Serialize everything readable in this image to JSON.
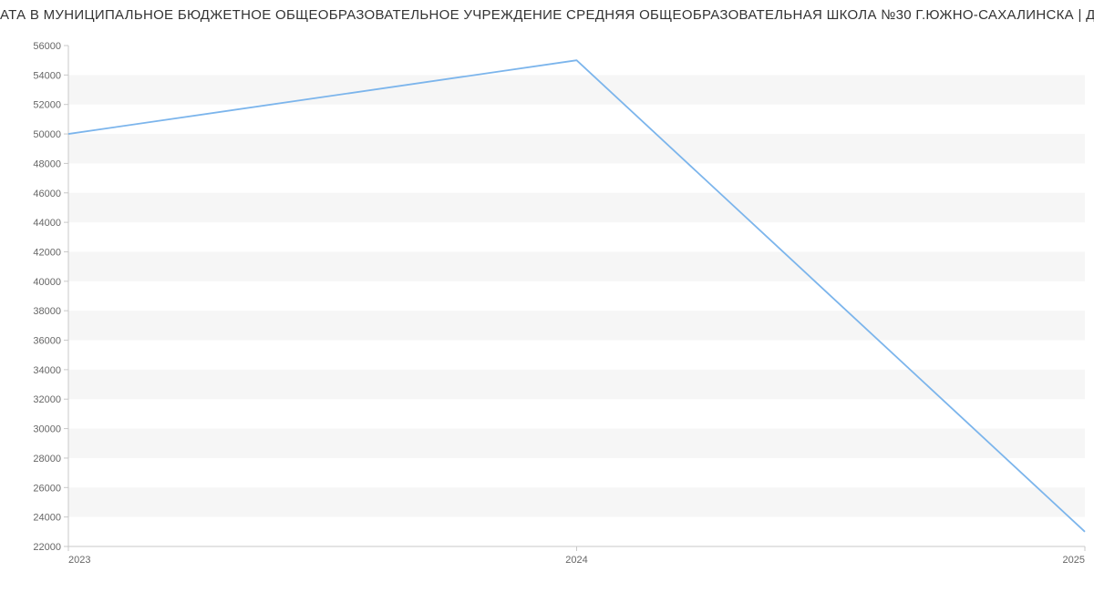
{
  "title": "АТА В МУНИЦИПАЛЬНОЕ БЮДЖЕТНОЕ ОБЩЕОБРАЗОВАТЕЛЬНОЕ УЧРЕЖДЕНИЕ СРЕДНЯЯ ОБЩЕОБРАЗОВАТЕЛЬНАЯ ШКОЛА №30 Г.ЮЖНО-САХАЛИНСКА | Данные mnogo",
  "chart_data": {
    "type": "line",
    "x": [
      2023,
      2024,
      2025
    ],
    "values": [
      50000,
      55000,
      23000
    ],
    "xlabel": "",
    "ylabel": "",
    "xlim": [
      2023,
      2025
    ],
    "ylim": [
      22000,
      56000
    ],
    "yticks": [
      22000,
      24000,
      26000,
      28000,
      30000,
      32000,
      34000,
      36000,
      38000,
      40000,
      42000,
      44000,
      46000,
      48000,
      50000,
      52000,
      54000,
      56000
    ],
    "xticks": [
      2023,
      2024,
      2025
    ],
    "line_color": "#7cb5ec",
    "grid_band_color": "#f6f6f6"
  }
}
